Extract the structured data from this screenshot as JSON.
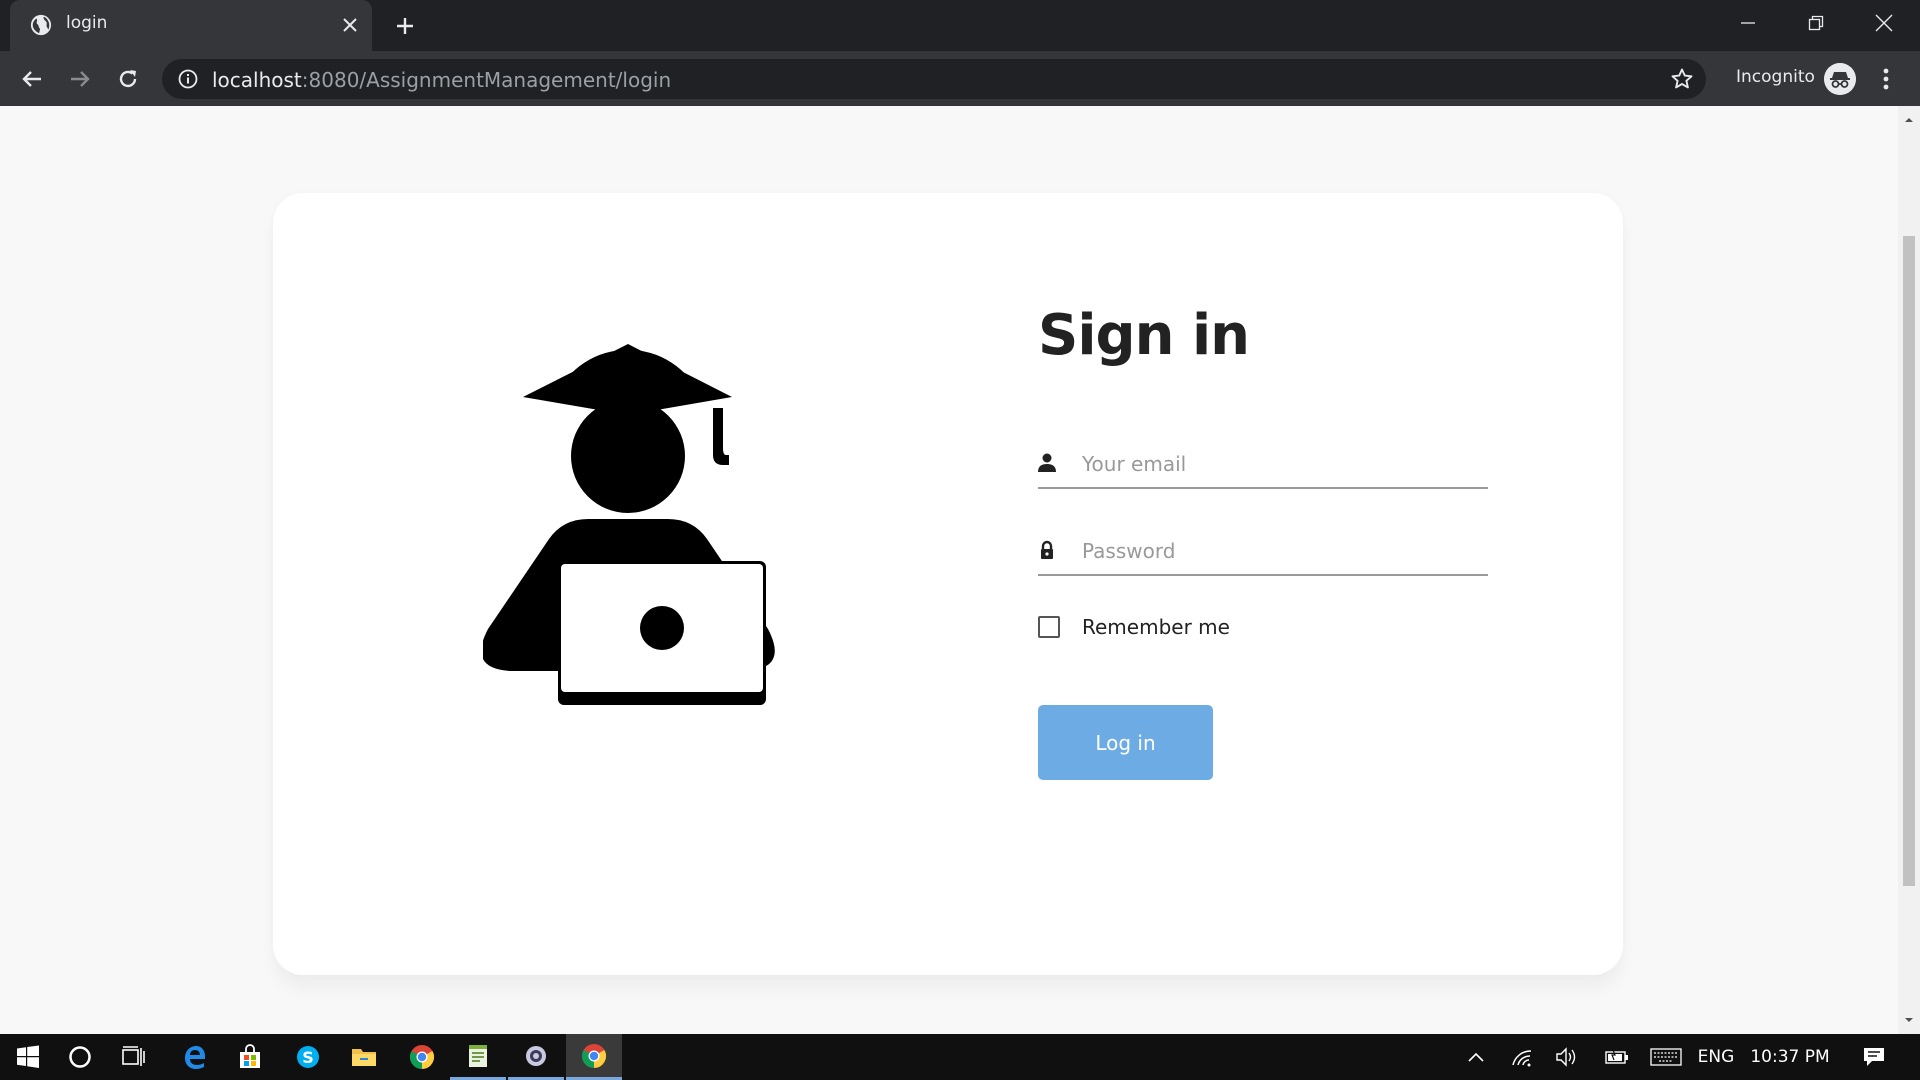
{
  "browser": {
    "tab_title": "login",
    "url_host": "localhost",
    "url_path": ":8080/AssignmentManagement/login",
    "incognito_label": "Incognito"
  },
  "login": {
    "title": "Sign in",
    "email_placeholder": "Your email",
    "password_placeholder": "Password",
    "remember_label": "Remember me",
    "button_label": "Log in"
  },
  "taskbar": {
    "language": "ENG",
    "time": "10:37 PM"
  },
  "colors": {
    "button": "#6dabe4",
    "page_background": "#f8f8f8",
    "card_background": "#ffffff"
  }
}
